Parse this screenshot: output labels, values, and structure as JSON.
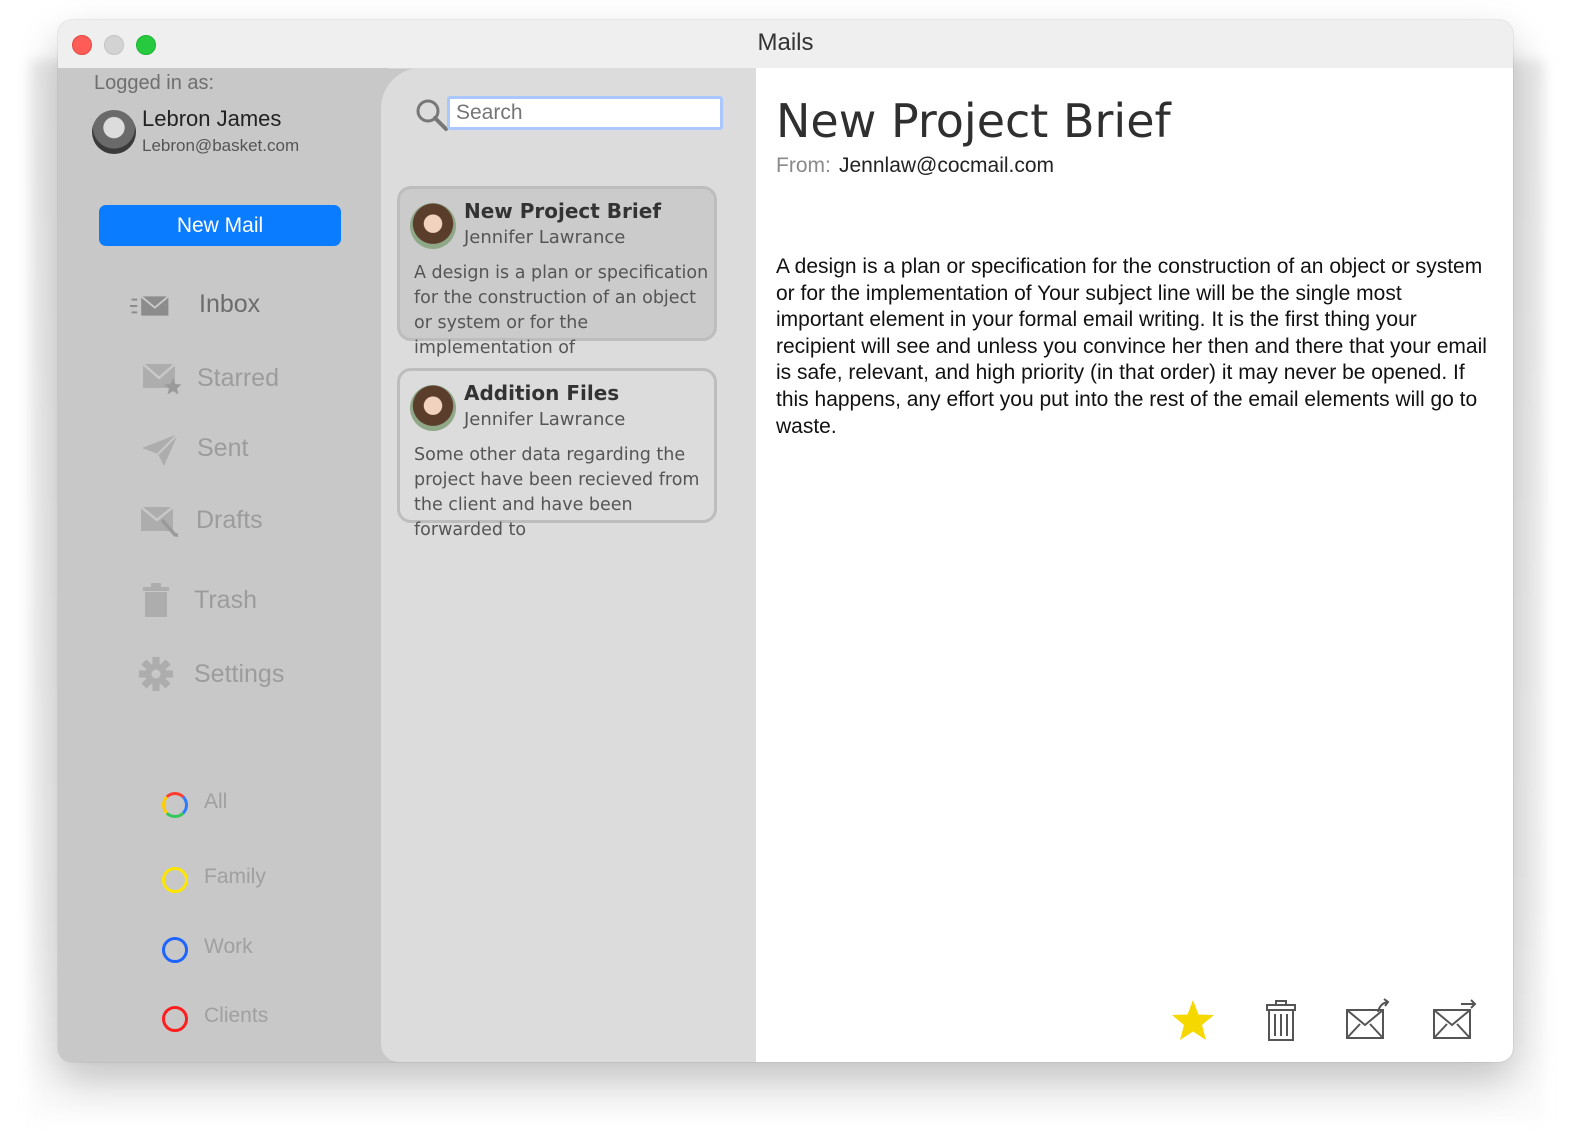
{
  "window": {
    "title": "Mails"
  },
  "sidebar": {
    "logged_in_label": "Logged in as:",
    "user": {
      "name": "Lebron James",
      "email": "Lebron@basket.com"
    },
    "new_mail_label": "New Mail",
    "items": [
      {
        "label": "Inbox",
        "icon": "inbox-icon"
      },
      {
        "label": "Starred",
        "icon": "starred-icon"
      },
      {
        "label": "Sent",
        "icon": "sent-icon"
      },
      {
        "label": "Drafts",
        "icon": "drafts-icon"
      },
      {
        "label": "Trash",
        "icon": "trash-icon"
      },
      {
        "label": "Settings",
        "icon": "gear-icon"
      }
    ],
    "tags": [
      {
        "label": "All",
        "color": "rainbow"
      },
      {
        "label": "Family",
        "color": "#ffe600"
      },
      {
        "label": "Work",
        "color": "#1e64ff"
      },
      {
        "label": "Clients",
        "color": "#ff1e1e"
      }
    ]
  },
  "search": {
    "placeholder": "Search"
  },
  "mails": [
    {
      "title": "New Project Brief",
      "sender": "Jennifer Lawrance",
      "preview": "A design is a plan or specification for the construction of an object or system or for the implementation of"
    },
    {
      "title": "Addition Files",
      "sender": "Jennifer Lawrance",
      "preview": "Some other data regarding the project have been recieved from the client and have been forwarded to"
    }
  ],
  "reading": {
    "title": "New Project Brief",
    "from_label": "From:",
    "from": "Jennlaw@cocmail.com",
    "body": "A design is a plan or specification for the construction of an object or system or for the implementation of Your subject line will be the single most important element in your formal email writing. It is the first thing your recipient will see and unless you convince her then and there that your email is safe, relevant, and high priority (in that order) it may never be opened. If this happens, any effort you put into the rest of the email elements will go to waste."
  },
  "colors": {
    "accent": "#0a7cff",
    "star": "#f5d800"
  }
}
